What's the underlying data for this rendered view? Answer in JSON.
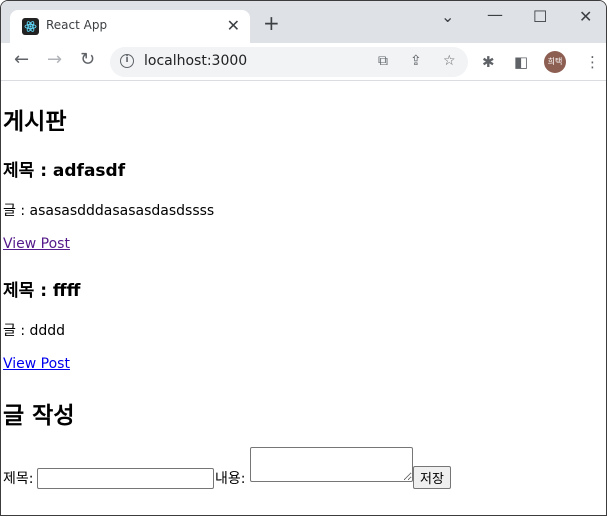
{
  "browser": {
    "tab_title": "React App",
    "url": "localhost:3000",
    "profile_initials": "희택",
    "icons": [
      "react-favicon",
      "close-icon",
      "plus-icon",
      "chevron-down-icon",
      "minimize-icon",
      "maximize-icon",
      "close-window-icon",
      "back-icon",
      "forward-icon",
      "reload-icon",
      "info-icon",
      "translate-icon",
      "share-icon",
      "star-icon",
      "extensions-icon",
      "side-panel-icon",
      "menu-icon"
    ]
  },
  "page": {
    "title": "게시판",
    "posts": [
      {
        "heading": "제목 : adfasdf",
        "body": "글 : asasasdddasasasdasdssss",
        "link": "View Post",
        "visited": true
      },
      {
        "heading": "제목 : ffff",
        "body": "글 : dddd",
        "link": "View Post",
        "visited": false
      }
    ],
    "form": {
      "heading": "글 작성",
      "title_label": "제목:",
      "title_value": "",
      "content_label": "내용:",
      "content_value": "",
      "submit_label": "저장"
    }
  }
}
